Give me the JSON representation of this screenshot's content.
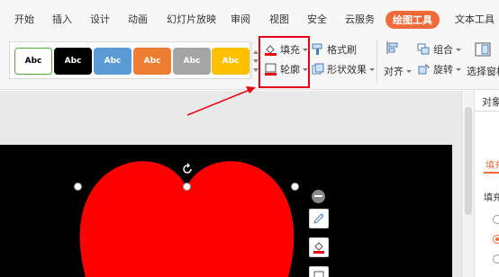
{
  "menu": {
    "tabs": [
      "开始",
      "插入",
      "设计",
      "动画",
      "幻灯片放映",
      "审阅",
      "视图",
      "安全",
      "云服务",
      "绘图工具",
      "文本工具"
    ],
    "active": "绘图工具"
  },
  "ribbon": {
    "styles": [
      {
        "label": "Abc",
        "bg": "#ffffff",
        "fg": "#000000",
        "border": "#5aaa4a"
      },
      {
        "label": "Abc",
        "bg": "#000000",
        "fg": "#ffffff",
        "border": "#000000"
      },
      {
        "label": "Abc",
        "bg": "#5b9bd5",
        "fg": "#ffffff",
        "border": "#5b9bd5"
      },
      {
        "label": "Abc",
        "bg": "#ed7d31",
        "fg": "#ffffff",
        "border": "#ed7d31"
      },
      {
        "label": "Abc",
        "bg": "#a5a5a5",
        "fg": "#ffffff",
        "border": "#a5a5a5"
      },
      {
        "label": "Abc",
        "bg": "#ffc000",
        "fg": "#ffffff",
        "border": "#ffc000"
      }
    ],
    "fill_label": "填充",
    "outline_label": "轮廓",
    "format_painter_label": "格式刷",
    "shape_effects_label": "形状效果",
    "align_label": "对齐",
    "group_label": "组合",
    "rotate_label": "旋转",
    "selection_pane_label": "选择窗格"
  },
  "pane": {
    "title": "对象属性",
    "fill_tab": "填充与线条",
    "section": "填充"
  },
  "colors": {
    "accent": "#f06a3b",
    "highlight": "#e60012",
    "shape_fill": "#ff0000",
    "slide_bg": "#000000"
  }
}
